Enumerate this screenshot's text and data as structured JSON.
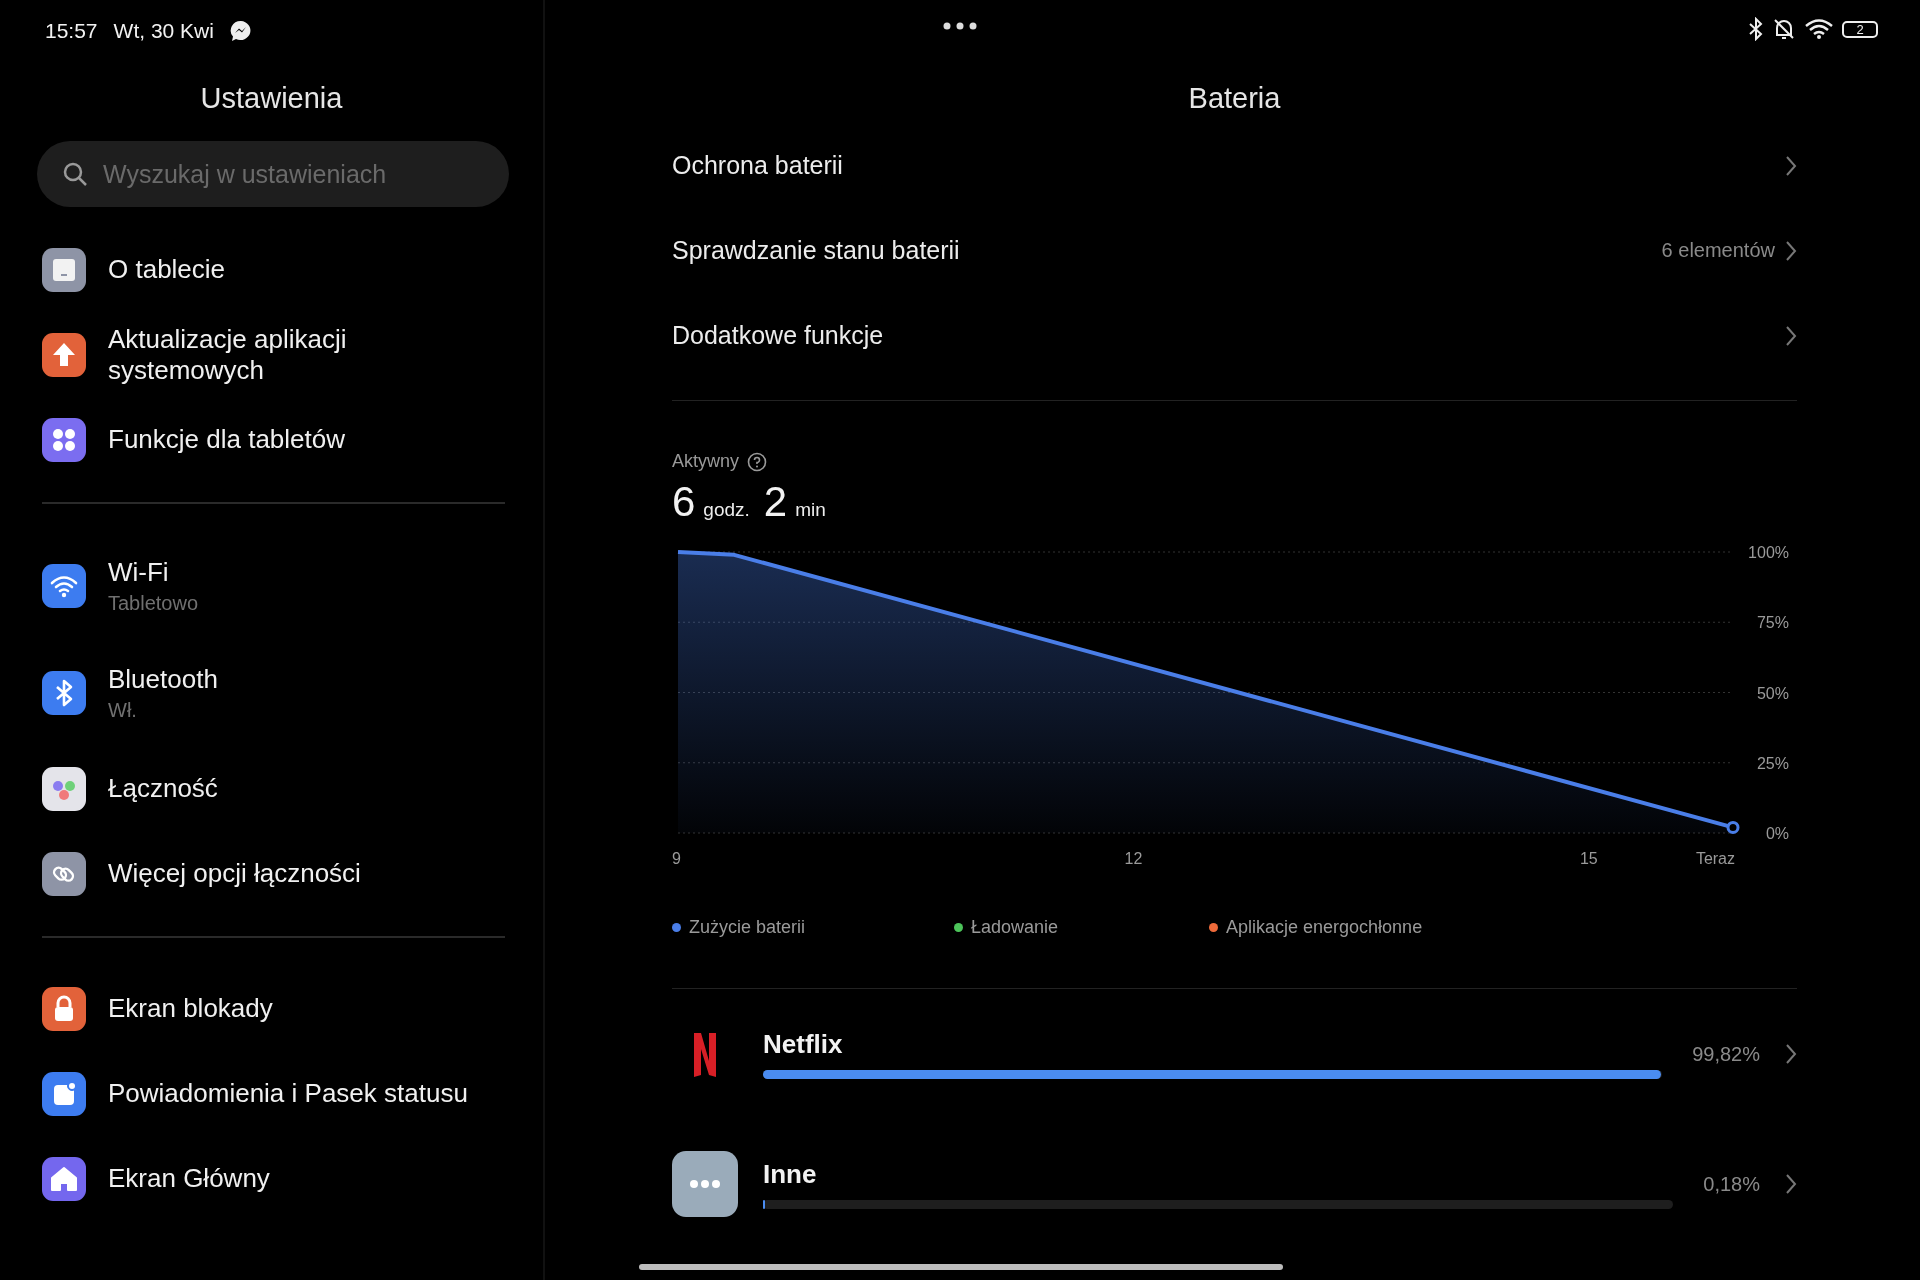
{
  "status_bar": {
    "time": "15:57",
    "date": "Wt, 30 Kwi",
    "battery": "2"
  },
  "sidebar": {
    "title": "Ustawienia",
    "search": {
      "placeholder": "Wyszukaj w ustawieniach"
    },
    "groups": [
      {
        "items": [
          {
            "label": "O tablecie"
          },
          {
            "label": "Aktualizacje aplikacji systemowych"
          },
          {
            "label": "Funkcje dla tabletów"
          }
        ]
      },
      {
        "items": [
          {
            "label": "Wi-Fi",
            "subtitle": "Tabletowo"
          },
          {
            "label": "Bluetooth",
            "subtitle": "Wł."
          },
          {
            "label": "Łączność"
          },
          {
            "label": "Więcej opcji łączności"
          }
        ]
      },
      {
        "items": [
          {
            "label": "Ekran blokady"
          },
          {
            "label": "Powiadomienia i Pasek statusu"
          },
          {
            "label": "Ekran Główny"
          }
        ]
      }
    ]
  },
  "main": {
    "title": "Bateria",
    "rows": [
      {
        "label": "Ochrona baterii"
      },
      {
        "label": "Sprawdzanie stanu baterii",
        "value": "6 elementów"
      },
      {
        "label": "Dodatkowe funkcje"
      }
    ],
    "active": {
      "label": "Aktywny",
      "hours": "6",
      "hours_unit": "godz.",
      "minutes": "2",
      "minutes_unit": "min"
    },
    "chart_data": {
      "type": "area",
      "grid": true,
      "x": [
        9,
        9.37,
        15.95
      ],
      "series": [
        {
          "name": "Zużycie baterii",
          "color": "#4a7ee8",
          "values": [
            100,
            99,
            2
          ]
        }
      ],
      "xlim": [
        9,
        15.95
      ],
      "ylim": [
        0,
        100
      ],
      "xticks": [
        9,
        12,
        15,
        {
          "value": 15.95,
          "label": "Teraz"
        }
      ],
      "yticks": [
        {
          "value": 100,
          "label": "100%"
        },
        {
          "value": 75,
          "label": "75%"
        },
        {
          "value": 50,
          "label": "50%"
        },
        {
          "value": 25,
          "label": "25%"
        },
        {
          "value": 0,
          "label": "0%"
        }
      ]
    },
    "legend": [
      {
        "label": "Ładowanie",
        "color": "#4cc45a"
      },
      {
        "label": "Aplikacje energochłonne",
        "color": "#ee6a3a"
      }
    ],
    "apps": [
      {
        "kind": "netflix",
        "name": "Netflix",
        "percent": "99,82%",
        "level": 0.9982
      },
      {
        "kind": "other",
        "name": "Inne",
        "percent": "0,18%",
        "level": 0.0018
      }
    ]
  }
}
